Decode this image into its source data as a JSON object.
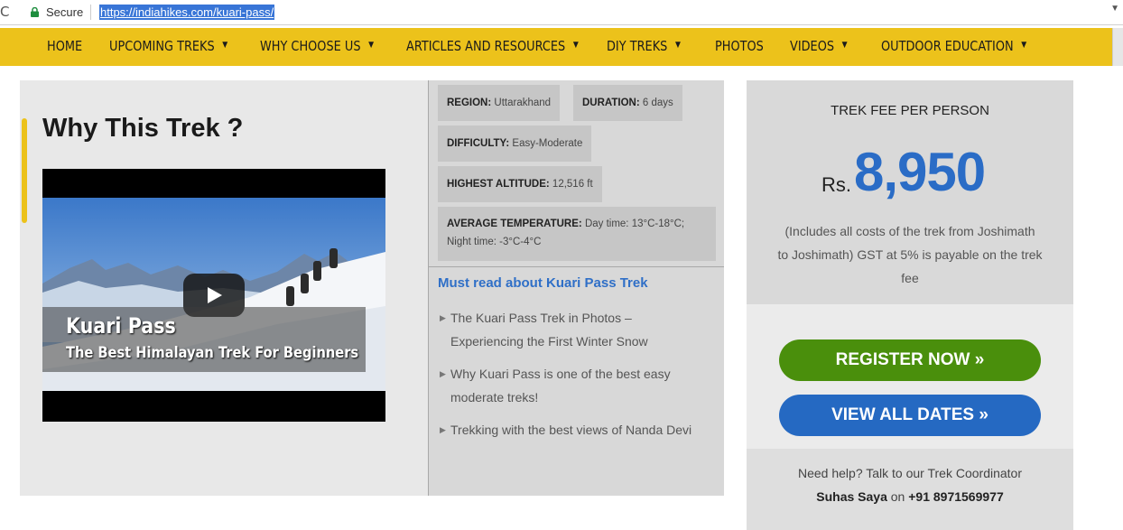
{
  "browser": {
    "secure_label": "Secure",
    "url": "https://indiahikes.com/kuari-pass/"
  },
  "nav": {
    "items": [
      {
        "label": "HOME",
        "has_caret": false
      },
      {
        "label": "UPCOMING TREKS",
        "has_caret": true
      },
      {
        "label": "WHY CHOOSE US",
        "has_caret": true
      },
      {
        "label": "ARTICLES AND RESOURCES",
        "has_caret": true
      },
      {
        "label": "DIY TREKS",
        "has_caret": true
      },
      {
        "label": "PHOTOS",
        "has_caret": false
      },
      {
        "label": "VIDEOS",
        "has_caret": true
      },
      {
        "label": "OUTDOOR EDUCATION",
        "has_caret": true
      }
    ],
    "caret": "▼",
    "bg_color": "#ecc21b"
  },
  "why": {
    "title": "Why This Trek ?",
    "video_title": "Kuari Pass",
    "video_subtitle": "The Best Himalayan Trek For Beginners"
  },
  "facts": {
    "region_label": "REGION:",
    "region_value": "Uttarakhand",
    "duration_label": "DURATION:",
    "duration_value": "6 days",
    "difficulty_label": "DIFFICULTY:",
    "difficulty_value": "Easy-Moderate",
    "altitude_label": "HIGHEST ALTITUDE:",
    "altitude_value": "12,516 ft",
    "temp_label": "AVERAGE TEMPERATURE:",
    "temp_value_1": "Day time: 13°C-18°C;",
    "temp_value_2": "Night time: -3°C-4°C"
  },
  "must_read": {
    "heading": "Must read about Kuari Pass Trek",
    "links": [
      {
        "line1": "The Kuari Pass Trek in Photos –",
        "line2": "Experiencing the First Winter Snow"
      },
      {
        "line1": "Why Kuari Pass is one of the best easy",
        "line2": "moderate treks!"
      },
      {
        "line1": "Trekking with the best views of Nanda Devi",
        "line2": ""
      }
    ]
  },
  "fee": {
    "label": "TREK FEE PER PERSON",
    "currency": "Rs.",
    "amount": "8,950",
    "note_1": "(Includes all costs of the trek from Joshimath",
    "note_2": "to Joshimath) GST at 5% is payable on the trek",
    "note_3": "fee",
    "register_label": "REGISTER NOW »",
    "dates_label": "VIEW ALL DATES »",
    "help_text": "Need help? Talk to our Trek Coordinator",
    "coordinator_name": "Suhas Saya",
    "on_word": "on",
    "phone": "+91 8971569977",
    "register_color": "#4a8f0c",
    "dates_color": "#2569c2",
    "price_color": "#2a6cc6"
  }
}
